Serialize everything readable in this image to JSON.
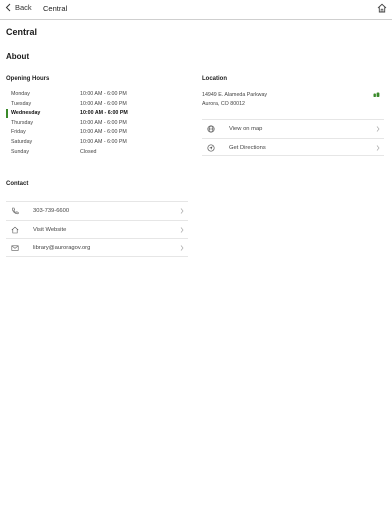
{
  "nav": {
    "back_label": "Back",
    "title": "Central"
  },
  "page": {
    "title": "Central",
    "section": "About"
  },
  "hours": {
    "heading": "Opening Hours",
    "rows": [
      {
        "day": "Monday",
        "time": "10:00 AM - 6:00 PM",
        "current": false
      },
      {
        "day": "Tuesday",
        "time": "10:00 AM - 6:00 PM",
        "current": false
      },
      {
        "day": "Wednesday",
        "time": "10:00 AM - 6:00 PM",
        "current": true
      },
      {
        "day": "Thursday",
        "time": "10:00 AM - 6:00 PM",
        "current": false
      },
      {
        "day": "Friday",
        "time": "10:00 AM - 6:00 PM",
        "current": false
      },
      {
        "day": "Saturday",
        "time": "10:00 AM - 6:00 PM",
        "current": false
      },
      {
        "day": "Sunday",
        "time": "Closed",
        "current": false
      }
    ]
  },
  "location": {
    "heading": "Location",
    "address_line1": "14949 E. Alameda Parkway",
    "address_line2": "Aurora, CO 80012",
    "actions": [
      {
        "label": "View on map",
        "icon": "globe-icon"
      },
      {
        "label": "Get Directions",
        "icon": "directions-icon"
      }
    ]
  },
  "contact": {
    "heading": "Contact",
    "items": [
      {
        "label": "303-739-6600",
        "icon": "phone-icon"
      },
      {
        "label": "Visit Website",
        "icon": "home-icon"
      },
      {
        "label": "library@auroragov.org",
        "icon": "mail-icon"
      }
    ]
  },
  "colors": {
    "accent": "#3a8a2a",
    "divider": "#e6e6e6"
  }
}
